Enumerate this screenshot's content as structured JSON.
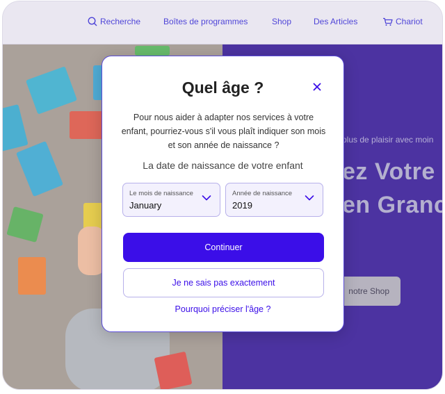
{
  "nav": {
    "search_label": "Recherche",
    "programs_label": "Boîtes de programmes",
    "shop_label": "Shop",
    "articles_label": "Des Articles",
    "cart_label": "Chariot"
  },
  "hero": {
    "subtitle": "plus de plaisir avec moin",
    "headline_line1": "ez Votre I",
    "headline_line2": "en Granc",
    "button_label": "notre Shop"
  },
  "modal": {
    "title": "Quel âge ?",
    "description": "Pour nous aider à adapter nos services à votre enfant, pourriez-vous s'il vous plaît indiquer son mois et son année de naissance ?",
    "subheading": "La date de naissance de votre enfant",
    "month_select": {
      "label": "Le mois de naissance",
      "value": "January"
    },
    "year_select": {
      "label": "Année de naissance",
      "value": "2019"
    },
    "continue_label": "Continuer",
    "unknown_label": "Je ne sais pas exactement",
    "why_link": "Pourquoi préciser l'âge ?"
  },
  "colors": {
    "accent": "#3b0ee8",
    "hero_bg": "#2a0c8f",
    "nav_text": "#2b1fd0"
  },
  "icons": [
    "search-icon",
    "cart-icon",
    "close-icon",
    "chevron-down-icon"
  ]
}
